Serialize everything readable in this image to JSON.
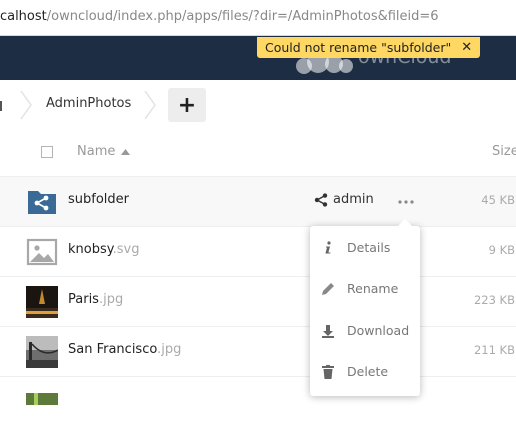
{
  "browser": {
    "url_host": "ocalhost",
    "url_path": "/owncloud/index.php/apps/files/?dir=/AdminPhotos&fileid=6"
  },
  "header": {
    "brand_word": "ownCloud",
    "header_color": "#1d2d44"
  },
  "notification": {
    "message": "Could not rename \"subfolder\"",
    "close_glyph": "✕",
    "color": "#fed862"
  },
  "breadcrumb": {
    "home_icon": "home-icon",
    "items": [
      {
        "label": "AdminPhotos"
      }
    ],
    "add_button_label": "+"
  },
  "table": {
    "columns": {
      "name": "Name",
      "size": "Size"
    },
    "rows": [
      {
        "name": "subfolder",
        "ext": "",
        "size": "45 KB",
        "icon": "shared-folder-icon",
        "shared_with": "admin"
      },
      {
        "name": "knobsy",
        "ext": ".svg",
        "size": "9 KB",
        "icon": "image-file-icon"
      },
      {
        "name": "Paris",
        "ext": ".jpg",
        "size": "223 KB",
        "icon": "photo-thumbnail"
      },
      {
        "name": "San Francisco",
        "ext": ".jpg",
        "size": "211 KB",
        "icon": "photo-thumbnail"
      }
    ]
  },
  "menu": {
    "items": [
      {
        "label": "Details",
        "icon": "info-icon"
      },
      {
        "label": "Rename",
        "icon": "pencil-icon"
      },
      {
        "label": "Download",
        "icon": "download-icon"
      },
      {
        "label": "Delete",
        "icon": "trash-icon"
      }
    ]
  }
}
